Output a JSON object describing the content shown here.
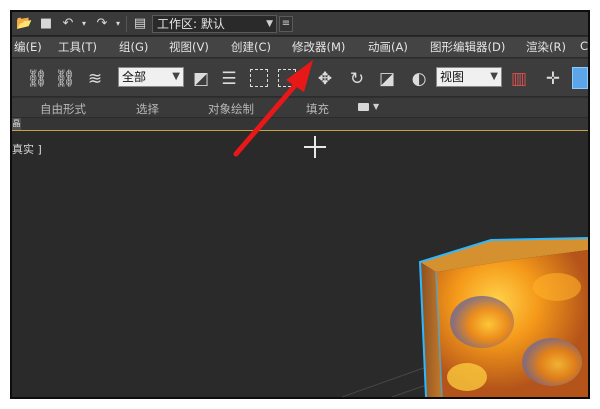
{
  "quick_access": {
    "workspace_label": "工作区: 默认"
  },
  "menu": {
    "items": [
      {
        "label": "编(E)"
      },
      {
        "label": "工具(T)"
      },
      {
        "label": "组(G)"
      },
      {
        "label": "视图(V)"
      },
      {
        "label": "创建(C)"
      },
      {
        "label": "修改器(M)"
      },
      {
        "label": "动画(A)"
      },
      {
        "label": "图形编辑器(D)"
      },
      {
        "label": "渲染(R)"
      },
      {
        "label": "C"
      }
    ]
  },
  "toolbar": {
    "filter_select": "全部",
    "coord_select": "视图"
  },
  "ribbon": {
    "tabs": [
      {
        "label": "自由形式"
      },
      {
        "label": "选择"
      },
      {
        "label": "对象绘制"
      },
      {
        "label": "填充"
      }
    ]
  },
  "substrip": {
    "label": "晶"
  },
  "viewport": {
    "label": "真实 ]"
  },
  "colors": {
    "annotation_arrow": "#e81818",
    "selection_outline": "#2fb8ff",
    "active_tool": "#5ba5e8"
  }
}
